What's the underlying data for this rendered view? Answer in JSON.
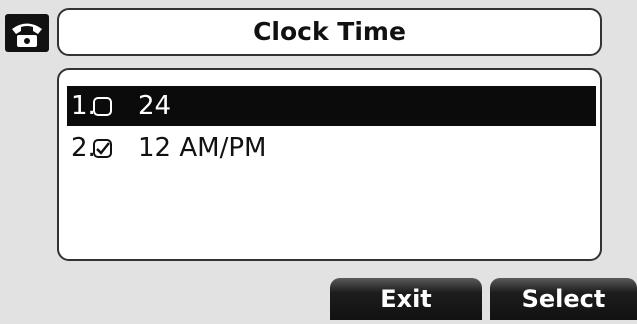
{
  "header": {
    "status_icon": "phone-handset-icon",
    "title": "Clock Time"
  },
  "list": {
    "items": [
      {
        "number": "1.",
        "checked": false,
        "label": "24",
        "selected": true
      },
      {
        "number": "2.",
        "checked": true,
        "label": "12 AM/PM",
        "selected": false
      }
    ]
  },
  "softkeys": {
    "exit_label": "Exit",
    "select_label": "Select"
  }
}
